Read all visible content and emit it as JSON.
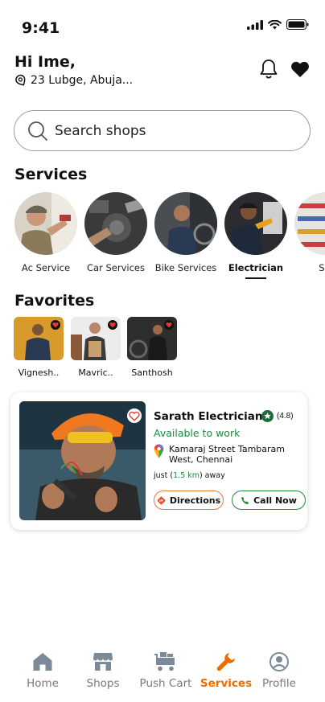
{
  "status_bar": {
    "time": "9:41"
  },
  "header": {
    "greeting": "Hi Ime,",
    "location": "23 Lubge, Abuja..."
  },
  "search": {
    "placeholder": "Search shops"
  },
  "services": {
    "title": "Services",
    "items": [
      {
        "label": "Ac Service",
        "active": false
      },
      {
        "label": "Car Services",
        "active": false
      },
      {
        "label": "Bike Services",
        "active": false
      },
      {
        "label": "Electrician",
        "active": true
      },
      {
        "label": "Sal",
        "active": false
      }
    ]
  },
  "favorites": {
    "title": "Favorites",
    "items": [
      {
        "name": "Vignesh.."
      },
      {
        "name": "Mavric.."
      },
      {
        "name": "Santhosh"
      }
    ]
  },
  "shop_card": {
    "name": "Sarath Electrician",
    "rating": "(4.8)",
    "availability": "Available to work",
    "address_line1": "Kamaraj Street Tambaram",
    "address_line2": "West, Chennai",
    "distance_prefix": "just (",
    "distance_value": "1.5 km",
    "distance_suffix": ") away",
    "directions_label": "Directions",
    "call_label": "Call Now"
  },
  "bottom_nav": {
    "items": [
      {
        "label": "Home",
        "icon": "home-icon",
        "active": false
      },
      {
        "label": "Shops",
        "icon": "shop-icon",
        "active": false
      },
      {
        "label": "Push Cart",
        "icon": "cart-icon",
        "active": false
      },
      {
        "label": "Services",
        "icon": "wrench-icon",
        "active": true
      },
      {
        "label": "Profile",
        "icon": "profile-icon",
        "active": false
      }
    ]
  },
  "colors": {
    "accent": "#ef6c00",
    "success": "#1e8a3c",
    "icon_gray": "#7a8a99",
    "directions_border": "#e07a3a"
  }
}
